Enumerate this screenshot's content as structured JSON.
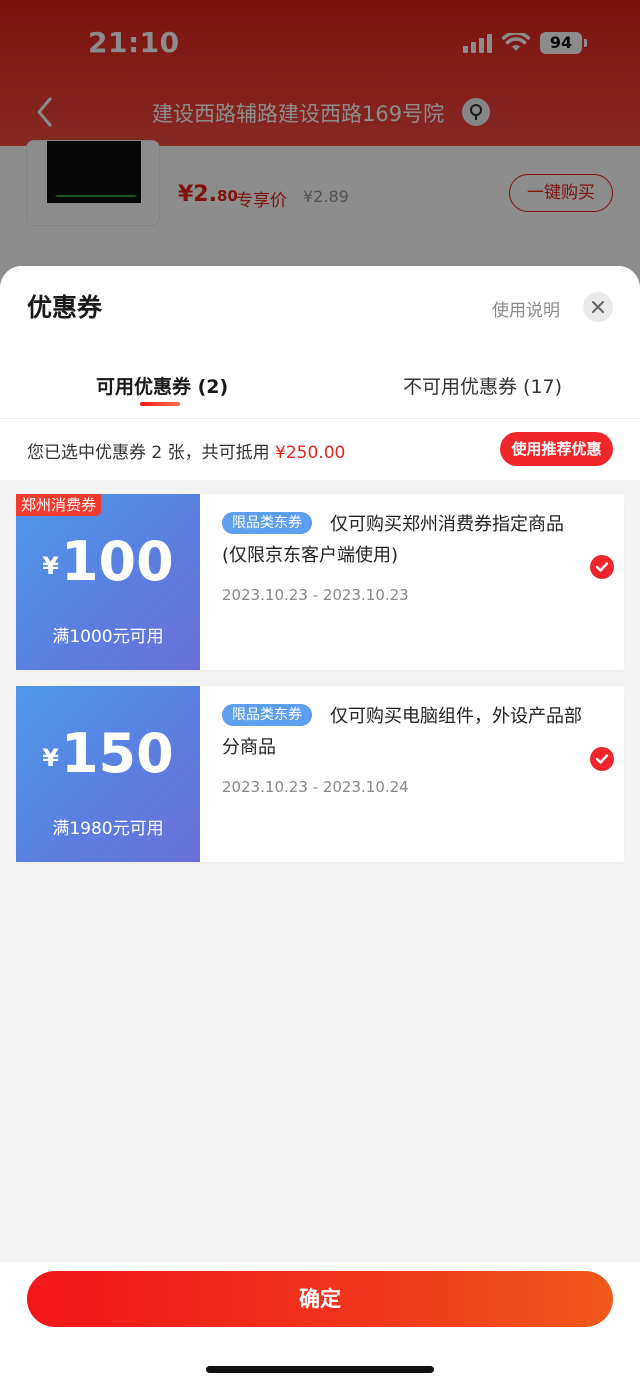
{
  "status_bar": {
    "time": "21:10",
    "battery": "94"
  },
  "header": {
    "address": "建设西路辅路建设西路169号院"
  },
  "product": {
    "price_main": "¥2.",
    "price_dec": "80",
    "price_tag": "专享价",
    "old_price": "¥2.89",
    "buy_label": "一键购买"
  },
  "sheet": {
    "title": "优惠券",
    "help_label": "使用说明",
    "tabs": [
      {
        "label": "可用优惠券 (2)"
      },
      {
        "label": "不可用优惠券 (17)"
      }
    ],
    "summary_prefix": "您已选中优惠券 2 张，共可抵用 ",
    "summary_amount": "¥250.00",
    "recommend_label": "使用推荐优惠"
  },
  "coupons": [
    {
      "tag": "郑州消费券",
      "currency": "¥",
      "amount": "100",
      "condition": "满1000元可用",
      "badge": "限品类东券",
      "description": "仅可购买郑州消费券指定商品(仅限京东客户端使用)",
      "date_range": "2023.10.23 - 2023.10.23",
      "selected": true
    },
    {
      "tag": "",
      "currency": "¥",
      "amount": "150",
      "condition": "满1980元可用",
      "badge": "限品类东券",
      "description": "仅可购买电脑组件，外设产品部分商品",
      "date_range": "2023.10.23 - 2023.10.24",
      "selected": true
    }
  ],
  "footer": {
    "confirm_label": "确定"
  },
  "colors": {
    "accent": "#f1262b",
    "coupon_blue": "#5a7fe0",
    "badge_blue": "#5f9ff0"
  }
}
